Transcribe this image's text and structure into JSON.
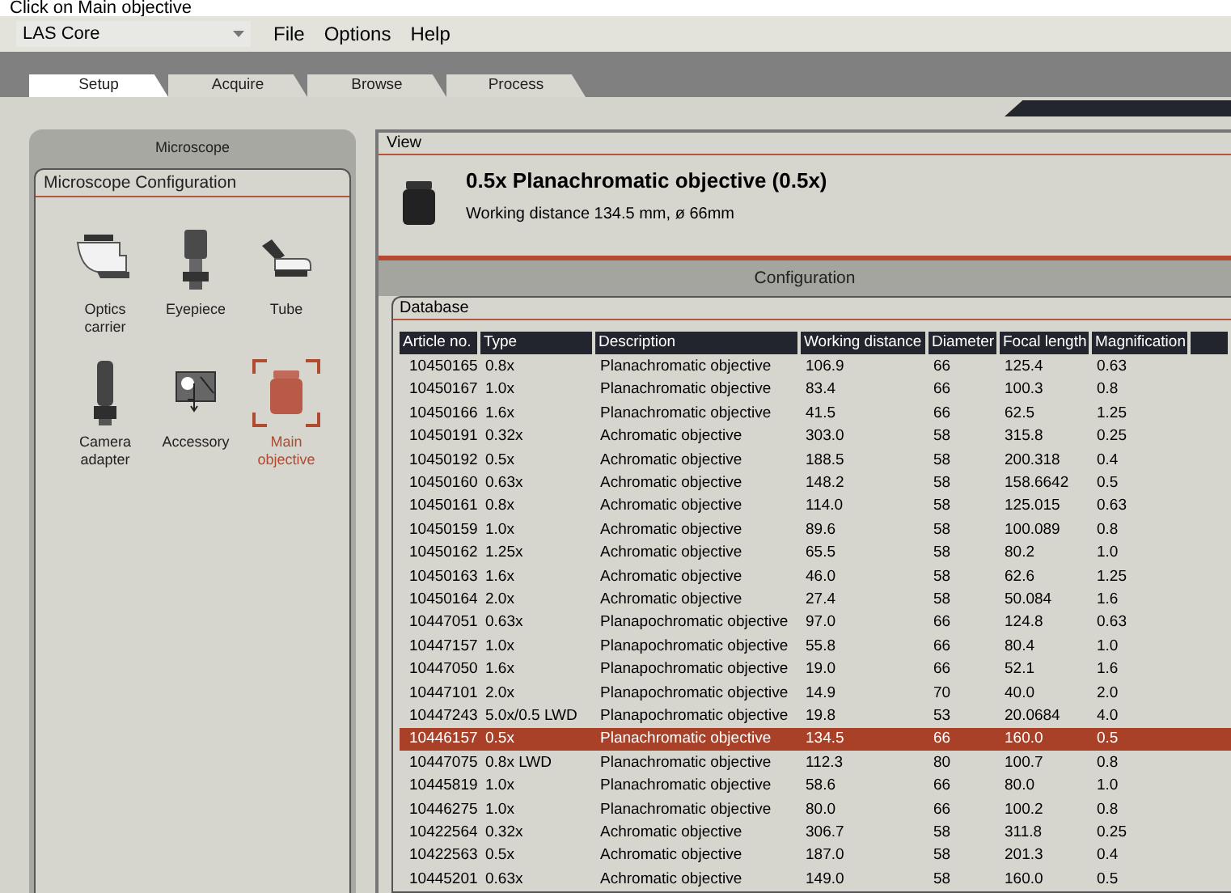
{
  "caption": "Click on Main objective",
  "app_selector": {
    "value": "LAS Core"
  },
  "menu": [
    "File",
    "Options",
    "Help"
  ],
  "tabs": [
    {
      "label": "Setup",
      "selected": true
    },
    {
      "label": "Acquire",
      "selected": false
    },
    {
      "label": "Browse",
      "selected": false
    },
    {
      "label": "Process",
      "selected": false
    }
  ],
  "left_panel": {
    "title": "Microscope",
    "group_title": "Microscope Configuration",
    "components": [
      {
        "label": "Optics carrier",
        "kind": "carrier",
        "selected": false
      },
      {
        "label": "Eyepiece",
        "kind": "eyepiece",
        "selected": false
      },
      {
        "label": "Tube",
        "kind": "tube",
        "selected": false
      },
      {
        "label": "Camera adapter",
        "kind": "camera",
        "selected": false
      },
      {
        "label": "Accessory",
        "kind": "accessory",
        "selected": false
      },
      {
        "label": "Main objective",
        "kind": "objective",
        "selected": true
      }
    ]
  },
  "view": {
    "title": "View",
    "objective_name": "0.5x Planachromatic objective (0.5x)",
    "details": "Working distance 134.5 mm, ø 66mm"
  },
  "configuration": {
    "title": "Configuration"
  },
  "database": {
    "title": "Database",
    "columns": [
      "Article no.",
      "Type",
      "Description",
      "Working distance",
      "Diameter",
      "Focal length",
      "Magnification"
    ],
    "rows": [
      {
        "cells": [
          "10450165",
          "0.8x",
          "Planachromatic objective",
          "106.9",
          "66",
          "125.4",
          "0.63"
        ],
        "selected": false
      },
      {
        "cells": [
          "10450167",
          "1.0x",
          "Planachromatic objective",
          "83.4",
          "66",
          "100.3",
          "0.8"
        ],
        "selected": false
      },
      {
        "cells": [
          "10450166",
          "1.6x",
          "Planachromatic objective",
          "41.5",
          "66",
          "62.5",
          "1.25"
        ],
        "selected": false
      },
      {
        "cells": [
          "10450191",
          "0.32x",
          "Achromatic objective",
          "303.0",
          "58",
          "315.8",
          "0.25"
        ],
        "selected": false
      },
      {
        "cells": [
          "10450192",
          "0.5x",
          "Achromatic objective",
          "188.5",
          "58",
          "200.318",
          "0.4"
        ],
        "selected": false
      },
      {
        "cells": [
          "10450160",
          "0.63x",
          "Achromatic objective",
          "148.2",
          "58",
          "158.6642",
          "0.5"
        ],
        "selected": false
      },
      {
        "cells": [
          "10450161",
          "0.8x",
          "Achromatic objective",
          "114.0",
          "58",
          "125.015",
          "0.63"
        ],
        "selected": false
      },
      {
        "cells": [
          "10450159",
          "1.0x",
          "Achromatic objective",
          "89.6",
          "58",
          "100.089",
          "0.8"
        ],
        "selected": false
      },
      {
        "cells": [
          "10450162",
          "1.25x",
          "Achromatic objective",
          "65.5",
          "58",
          "80.2",
          "1.0"
        ],
        "selected": false
      },
      {
        "cells": [
          "10450163",
          "1.6x",
          "Achromatic objective",
          "46.0",
          "58",
          "62.6",
          "1.25"
        ],
        "selected": false
      },
      {
        "cells": [
          "10450164",
          "2.0x",
          "Achromatic objective",
          "27.4",
          "58",
          "50.084",
          "1.6"
        ],
        "selected": false
      },
      {
        "cells": [
          "10447051",
          "0.63x",
          "Planapochromatic objective",
          "97.0",
          "66",
          "124.8",
          "0.63"
        ],
        "selected": false
      },
      {
        "cells": [
          "10447157",
          "1.0x",
          "Planapochromatic objective",
          "55.8",
          "66",
          "80.4",
          "1.0"
        ],
        "selected": false
      },
      {
        "cells": [
          "10447050",
          "1.6x",
          "Planapochromatic objective",
          "19.0",
          "66",
          "52.1",
          "1.6"
        ],
        "selected": false
      },
      {
        "cells": [
          "10447101",
          "2.0x",
          "Planapochromatic objective",
          "14.9",
          "70",
          "40.0",
          "2.0"
        ],
        "selected": false
      },
      {
        "cells": [
          "10447243",
          "5.0x/0.5 LWD",
          "Planapochromatic objective",
          "19.8",
          "53",
          "20.0684",
          "4.0"
        ],
        "selected": false
      },
      {
        "cells": [
          "10446157",
          "0.5x",
          "Planachromatic objective",
          "134.5",
          "66",
          "160.0",
          "0.5"
        ],
        "selected": true
      },
      {
        "cells": [
          "10447075",
          "0.8x LWD",
          "Planachromatic objective",
          "112.3",
          "80",
          "100.7",
          "0.8"
        ],
        "selected": false
      },
      {
        "cells": [
          "10445819",
          "1.0x",
          "Planachromatic objective",
          "58.6",
          "66",
          "80.0",
          "1.0"
        ],
        "selected": false
      },
      {
        "cells": [
          "10446275",
          "1.0x",
          "Planachromatic objective",
          "80.0",
          "66",
          "100.2",
          "0.8"
        ],
        "selected": false
      },
      {
        "cells": [
          "10422564",
          "0.32x",
          "Achromatic objective",
          "306.7",
          "58",
          "311.8",
          "0.25"
        ],
        "selected": false
      },
      {
        "cells": [
          "10422563",
          "0.5x",
          "Achromatic objective",
          "187.0",
          "58",
          "201.3",
          "0.4"
        ],
        "selected": false
      },
      {
        "cells": [
          "10445201",
          "0.63x",
          "Achromatic objective",
          "149.0",
          "58",
          "160.0",
          "0.5"
        ],
        "selected": false
      }
    ]
  }
}
